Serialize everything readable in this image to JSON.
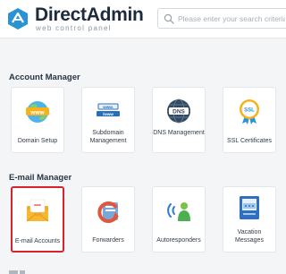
{
  "header": {
    "brand": "DirectAdmin",
    "tagline": "web control panel",
    "search_placeholder": "Please enter your search criteria"
  },
  "sections": [
    {
      "title": "Account Manager",
      "items": [
        {
          "label": "Domain Setup",
          "icon": "www-globe-icon"
        },
        {
          "label": "Subdomain Management",
          "icon": "subdomain-icon"
        },
        {
          "label": "DNS Management",
          "icon": "dns-icon"
        },
        {
          "label": "SSL Certificates",
          "icon": "ssl-badge-icon"
        }
      ]
    },
    {
      "title": "E-mail Manager",
      "items": [
        {
          "label": "E-mail Accounts",
          "icon": "email-envelope-icon",
          "selected": true
        },
        {
          "label": "Forwarders",
          "icon": "forwarder-icon"
        },
        {
          "label": "Autoresponders",
          "icon": "autoresponder-icon"
        },
        {
          "label": "Vacation Messages",
          "icon": "vacation-message-icon"
        }
      ]
    }
  ],
  "colors": {
    "accent": "#26a0da",
    "selected_border": "#d8232a",
    "heading": "#263545"
  }
}
